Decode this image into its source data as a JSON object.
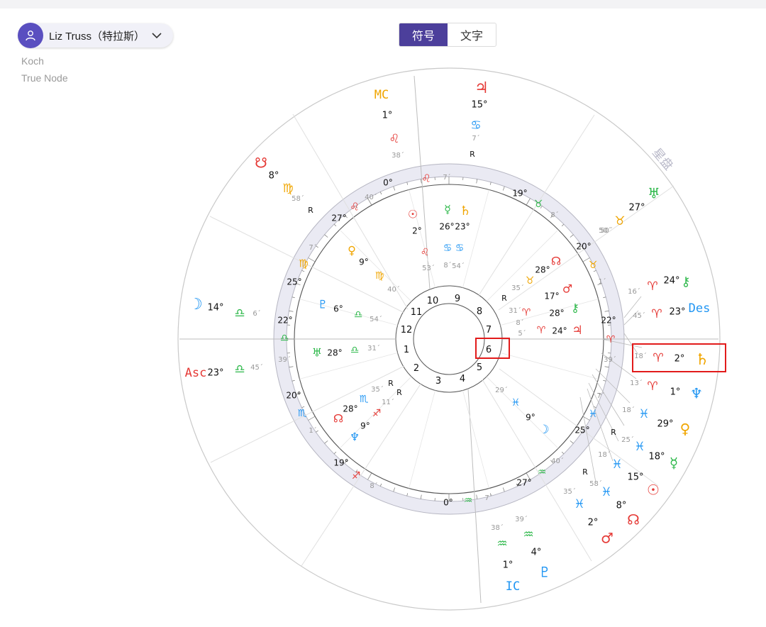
{
  "profile": {
    "name": "Liz Truss（特拉斯）"
  },
  "system": {
    "house_system": "Koch",
    "node_type": "True Node"
  },
  "view_toggle": {
    "symbols": "符号",
    "text": "文字"
  },
  "chart": {
    "asc_label": "Asc",
    "mc_label": "MC",
    "ic_label": "IC",
    "des_label": "Des",
    "watermark": "星盘",
    "houses": [
      "1",
      "2",
      "3",
      "4",
      "5",
      "6",
      "7",
      "8",
      "9",
      "10",
      "11",
      "12"
    ]
  },
  "colors": {
    "fire": "#e53935",
    "earth": "#f0a500",
    "air": "#2db84a",
    "water": "#2196f3",
    "accent": "#4c3f9b",
    "highlight": "#e21b1b"
  }
}
